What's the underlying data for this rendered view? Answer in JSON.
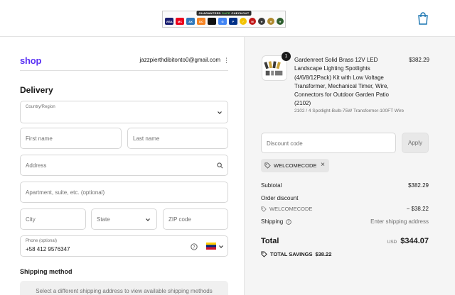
{
  "header": {
    "badge_title_prefix": "GUARANTEED ",
    "badge_title_safe": "SAFE",
    "badge_title_suffix": " CHECKOUT",
    "payment_icons": [
      {
        "name": "visa-icon",
        "label": "VISA",
        "color": "#1a1f71"
      },
      {
        "name": "mastercard-icon",
        "label": "MC",
        "color": "#eb001b"
      },
      {
        "name": "amex-icon",
        "label": "AX",
        "color": "#2e77bb"
      },
      {
        "name": "discover-icon",
        "label": "DC",
        "color": "#f58220"
      },
      {
        "name": "applepay-icon",
        "label": "",
        "color": "#111111"
      },
      {
        "name": "gpay-icon",
        "label": "G",
        "color": "#4285f4"
      },
      {
        "name": "paypal-icon",
        "label": "P",
        "color": "#003087"
      },
      {
        "name": "norton-seal-icon",
        "label": "✓",
        "color": "#f2c200"
      },
      {
        "name": "mcafee-seal-icon",
        "label": "M",
        "color": "#c01818"
      },
      {
        "name": "trust-seal-icon-1",
        "label": "★",
        "color": "#3a3a3a"
      },
      {
        "name": "trust-seal-icon-2",
        "label": "★",
        "color": "#b08a2e"
      },
      {
        "name": "trust-seal-icon-3",
        "label": "★",
        "color": "#2f5f2f"
      }
    ],
    "cart_icon": "shopping-bag-icon"
  },
  "contact": {
    "logo": "shop",
    "email": "jazzpierthdibitonto0@gmail.com"
  },
  "delivery": {
    "heading": "Delivery",
    "country_label": "Country/Region",
    "first_name_placeholder": "First name",
    "last_name_placeholder": "Last name",
    "address_placeholder": "Address",
    "apartment_placeholder": "Apartment, suite, etc. (optional)",
    "city_placeholder": "City",
    "state_placeholder": "State",
    "zip_placeholder": "ZIP code",
    "phone_label": "Phone (optional)",
    "phone_value": "+58 412 9576347",
    "flag": "venezuela-flag-icon"
  },
  "shipping": {
    "heading": "Shipping method",
    "notice": "Select a different shipping address to view available shipping methods"
  },
  "summary": {
    "product": {
      "quantity": "1",
      "title": "Gardenreet Solid Brass 12V LED Landscape Lighting Spotlights (4/6/8/12Pack) Kit with Low Voltage Transformer, Mechanical Timer, Wire, Connectors for Outdoor Garden Patio (2102)",
      "variant": "2102 / 4 Spotlight-Bulb-75W Transformer-100FT Wire",
      "price": "$382.29"
    },
    "discount_placeholder": "Discount code",
    "apply_label": "Apply",
    "applied_code": "WELCOMECODE",
    "subtotal_label": "Subtotal",
    "subtotal_value": "$382.29",
    "order_discount_label": "Order discount",
    "order_discount_code": "WELCOMECODE",
    "order_discount_value": "− $38.22",
    "shipping_label": "Shipping",
    "shipping_value": "Enter shipping address",
    "total_label": "Total",
    "total_currency": "USD",
    "total_value": "$344.07",
    "savings_label": "TOTAL SAVINGS",
    "savings_value": "$38.22"
  },
  "colors": {
    "shop_brand": "#5a31f4",
    "summary_background": "#f5f5f5"
  }
}
